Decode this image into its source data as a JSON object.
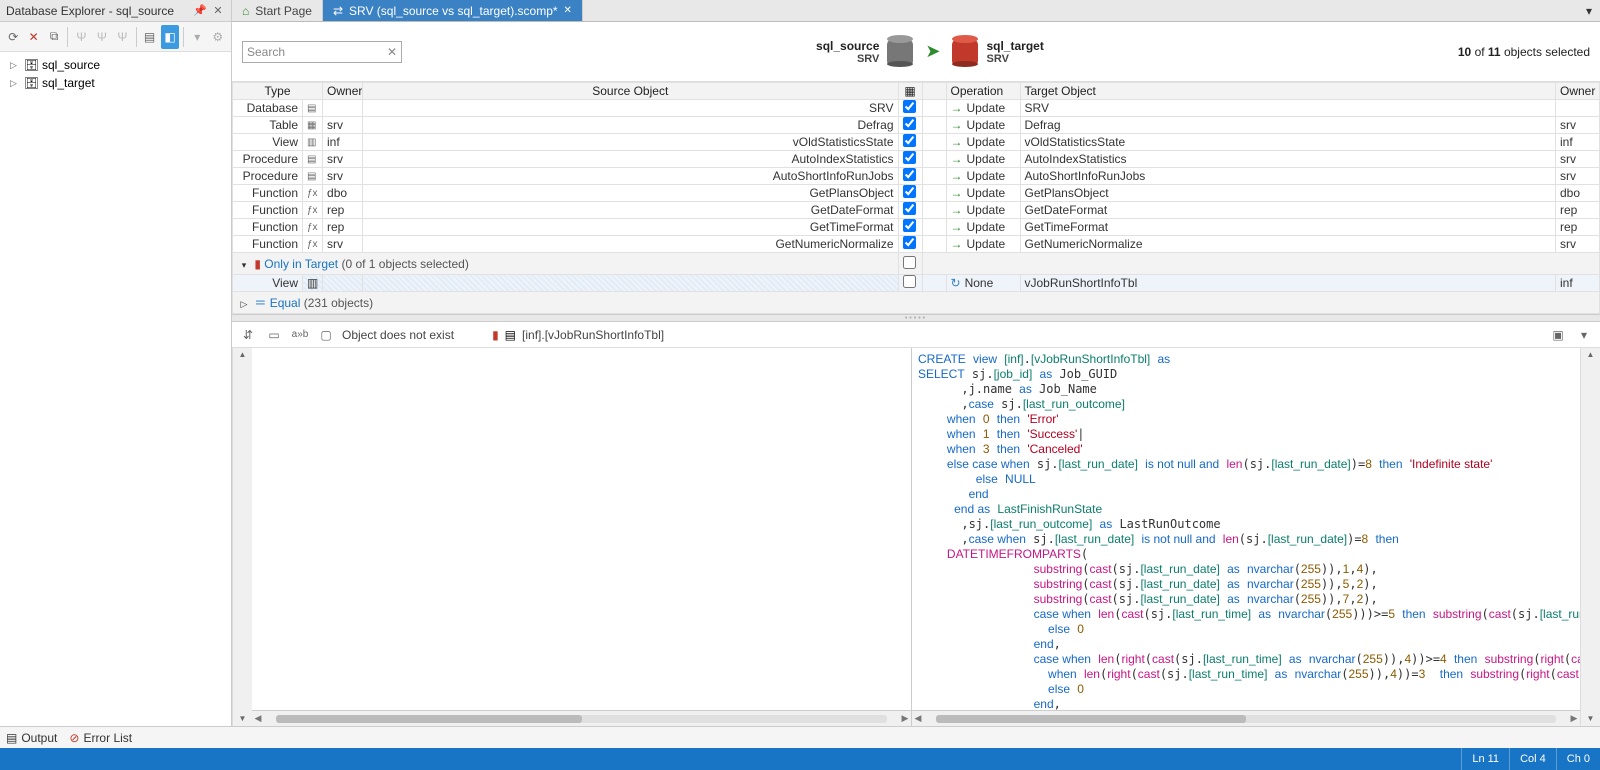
{
  "explorer": {
    "title": "Database Explorer - sql_source",
    "nodes": [
      "sql_source",
      "sql_target"
    ]
  },
  "search": {
    "placeholder": "Search"
  },
  "tabs": {
    "start": "Start Page",
    "active": "SRV (sql_source vs sql_target).scomp*"
  },
  "head": {
    "source_name": "sql_source",
    "source_srv": "SRV",
    "target_name": "sql_target",
    "target_srv": "SRV",
    "sel_count_a": "10",
    "sel_count_of": " of ",
    "sel_count_b": "11",
    "sel_count_tail": " objects selected"
  },
  "cols": {
    "type": "Type",
    "owner": "Owner",
    "source": "Source Object",
    "operation": "Operation",
    "target": "Target Object",
    "owner2": "Owner"
  },
  "rows": [
    {
      "type": "Database",
      "owner": "",
      "src": "SRV",
      "chk": true,
      "op": "Update",
      "tgt": "SRV",
      "owner2": ""
    },
    {
      "type": "Table",
      "owner": "srv",
      "src": "Defrag",
      "chk": true,
      "op": "Update",
      "tgt": "Defrag",
      "owner2": "srv"
    },
    {
      "type": "View",
      "owner": "inf",
      "src": "vOldStatisticsState",
      "chk": true,
      "op": "Update",
      "tgt": "vOldStatisticsState",
      "owner2": "inf"
    },
    {
      "type": "Procedure",
      "owner": "srv",
      "src": "AutoIndexStatistics",
      "chk": true,
      "op": "Update",
      "tgt": "AutoIndexStatistics",
      "owner2": "srv"
    },
    {
      "type": "Procedure",
      "owner": "srv",
      "src": "AutoShortInfoRunJobs",
      "chk": true,
      "op": "Update",
      "tgt": "AutoShortInfoRunJobs",
      "owner2": "srv"
    },
    {
      "type": "Function",
      "owner": "dbo",
      "src": "GetPlansObject",
      "chk": true,
      "op": "Update",
      "tgt": "GetPlansObject",
      "owner2": "dbo"
    },
    {
      "type": "Function",
      "owner": "rep",
      "src": "GetDateFormat",
      "chk": true,
      "op": "Update",
      "tgt": "GetDateFormat",
      "owner2": "rep"
    },
    {
      "type": "Function",
      "owner": "rep",
      "src": "GetTimeFormat",
      "chk": true,
      "op": "Update",
      "tgt": "GetTimeFormat",
      "owner2": "rep"
    },
    {
      "type": "Function",
      "owner": "srv",
      "src": "GetNumericNormalize",
      "chk": true,
      "op": "Update",
      "tgt": "GetNumericNormalize",
      "owner2": "srv"
    }
  ],
  "typeicons": {
    "Database": "▤",
    "Table": "▦",
    "View": "▥",
    "Procedure": "▤",
    "Function": "ƒx"
  },
  "group_only": {
    "label": "Only in Target ",
    "count": "(0 of 1 objects selected)"
  },
  "rare_row": {
    "type": "View",
    "op": "None",
    "tgt": "vJobRunShortInfoTbl",
    "owner2": "inf"
  },
  "group_equal": {
    "label": "Equal ",
    "count": "(231 objects)"
  },
  "lower": {
    "left_label": "Object does not exist",
    "right_label": "[inf].[vJobRunShortInfoTbl]"
  },
  "bottom": {
    "output": "Output",
    "errors": "Error List"
  },
  "status": {
    "ln": "Ln 11",
    "col": "Col 4",
    "ch": "Ch 0"
  }
}
